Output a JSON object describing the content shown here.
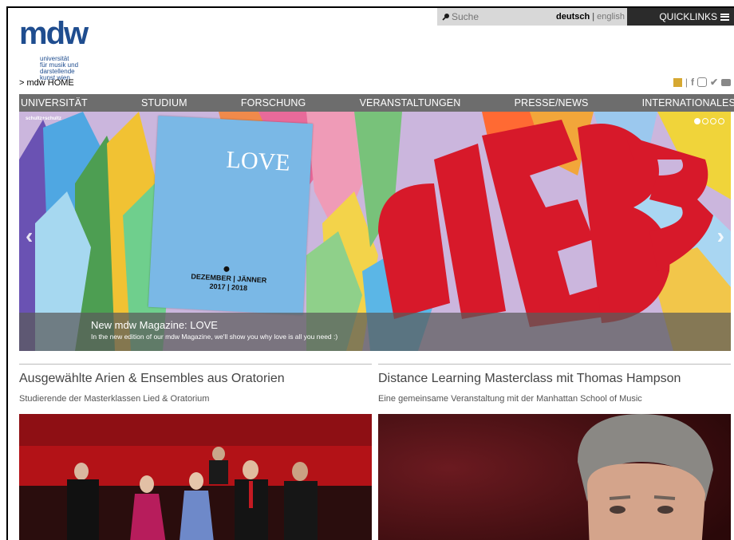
{
  "header": {
    "logo_mark": "mdw",
    "logo_lines": [
      "universität",
      "für musik und",
      "darstellende",
      "kunst wien"
    ],
    "breadcrumb": "> mdw HOME",
    "search_placeholder": "Suche",
    "lang_de": "deutsch",
    "lang_sep": "|",
    "lang_en": "english",
    "quicklinks": "QUICKLINKS",
    "social": [
      "store-icon",
      "facebook-icon",
      "instagram-icon",
      "twitter-icon",
      "youtube-icon"
    ]
  },
  "nav": {
    "items": [
      "UNIVERSITÄT",
      "STUDIUM",
      "FORSCHUNG",
      "VERANSTALTUNGEN",
      "PRESSE/NEWS",
      "INTERNATIONALES"
    ]
  },
  "hero": {
    "credit": "schultz+schultz",
    "caption_title": "New mdw Magazine: LOVE",
    "caption_text": "In the new edition of our mdw Magazine, we'll show you why love is all you need :)",
    "poster_word": "LOVE",
    "poster_date": "DEZEMBER | JÄNNER\n2017 | 2018",
    "lettering": "LIEBE",
    "slides_total": 4,
    "slide_active": 1
  },
  "articles": [
    {
      "title": "Ausgewählte Arien & Ensembles aus Oratorien",
      "subtitle": "Studierende der Masterklassen Lied & Oratorium"
    },
    {
      "title": "Distance Learning Masterclass mit Thomas Hampson",
      "subtitle": "Eine gemeinsame Veranstaltung mit der Manhattan School of Music"
    }
  ],
  "colors": {
    "brand_blue": "#1f4d8f",
    "nav_grey": "#6d6d6d",
    "quicklinks_bg": "#2b2b2b",
    "liebe_red": "#d7192a"
  }
}
